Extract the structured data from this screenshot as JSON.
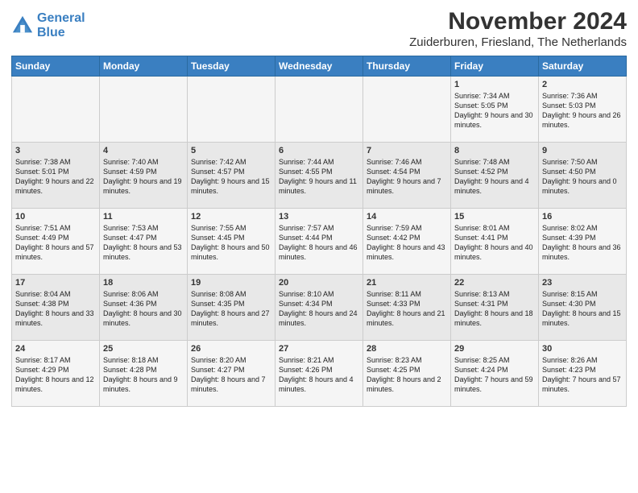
{
  "logo": {
    "line1": "General",
    "line2": "Blue"
  },
  "title": "November 2024",
  "subtitle": "Zuiderburen, Friesland, The Netherlands",
  "days_of_week": [
    "Sunday",
    "Monday",
    "Tuesday",
    "Wednesday",
    "Thursday",
    "Friday",
    "Saturday"
  ],
  "weeks": [
    [
      {
        "day": "",
        "info": ""
      },
      {
        "day": "",
        "info": ""
      },
      {
        "day": "",
        "info": ""
      },
      {
        "day": "",
        "info": ""
      },
      {
        "day": "",
        "info": ""
      },
      {
        "day": "1",
        "info": "Sunrise: 7:34 AM\nSunset: 5:05 PM\nDaylight: 9 hours and 30 minutes."
      },
      {
        "day": "2",
        "info": "Sunrise: 7:36 AM\nSunset: 5:03 PM\nDaylight: 9 hours and 26 minutes."
      }
    ],
    [
      {
        "day": "3",
        "info": "Sunrise: 7:38 AM\nSunset: 5:01 PM\nDaylight: 9 hours and 22 minutes."
      },
      {
        "day": "4",
        "info": "Sunrise: 7:40 AM\nSunset: 4:59 PM\nDaylight: 9 hours and 19 minutes."
      },
      {
        "day": "5",
        "info": "Sunrise: 7:42 AM\nSunset: 4:57 PM\nDaylight: 9 hours and 15 minutes."
      },
      {
        "day": "6",
        "info": "Sunrise: 7:44 AM\nSunset: 4:55 PM\nDaylight: 9 hours and 11 minutes."
      },
      {
        "day": "7",
        "info": "Sunrise: 7:46 AM\nSunset: 4:54 PM\nDaylight: 9 hours and 7 minutes."
      },
      {
        "day": "8",
        "info": "Sunrise: 7:48 AM\nSunset: 4:52 PM\nDaylight: 9 hours and 4 minutes."
      },
      {
        "day": "9",
        "info": "Sunrise: 7:50 AM\nSunset: 4:50 PM\nDaylight: 9 hours and 0 minutes."
      }
    ],
    [
      {
        "day": "10",
        "info": "Sunrise: 7:51 AM\nSunset: 4:49 PM\nDaylight: 8 hours and 57 minutes."
      },
      {
        "day": "11",
        "info": "Sunrise: 7:53 AM\nSunset: 4:47 PM\nDaylight: 8 hours and 53 minutes."
      },
      {
        "day": "12",
        "info": "Sunrise: 7:55 AM\nSunset: 4:45 PM\nDaylight: 8 hours and 50 minutes."
      },
      {
        "day": "13",
        "info": "Sunrise: 7:57 AM\nSunset: 4:44 PM\nDaylight: 8 hours and 46 minutes."
      },
      {
        "day": "14",
        "info": "Sunrise: 7:59 AM\nSunset: 4:42 PM\nDaylight: 8 hours and 43 minutes."
      },
      {
        "day": "15",
        "info": "Sunrise: 8:01 AM\nSunset: 4:41 PM\nDaylight: 8 hours and 40 minutes."
      },
      {
        "day": "16",
        "info": "Sunrise: 8:02 AM\nSunset: 4:39 PM\nDaylight: 8 hours and 36 minutes."
      }
    ],
    [
      {
        "day": "17",
        "info": "Sunrise: 8:04 AM\nSunset: 4:38 PM\nDaylight: 8 hours and 33 minutes."
      },
      {
        "day": "18",
        "info": "Sunrise: 8:06 AM\nSunset: 4:36 PM\nDaylight: 8 hours and 30 minutes."
      },
      {
        "day": "19",
        "info": "Sunrise: 8:08 AM\nSunset: 4:35 PM\nDaylight: 8 hours and 27 minutes."
      },
      {
        "day": "20",
        "info": "Sunrise: 8:10 AM\nSunset: 4:34 PM\nDaylight: 8 hours and 24 minutes."
      },
      {
        "day": "21",
        "info": "Sunrise: 8:11 AM\nSunset: 4:33 PM\nDaylight: 8 hours and 21 minutes."
      },
      {
        "day": "22",
        "info": "Sunrise: 8:13 AM\nSunset: 4:31 PM\nDaylight: 8 hours and 18 minutes."
      },
      {
        "day": "23",
        "info": "Sunrise: 8:15 AM\nSunset: 4:30 PM\nDaylight: 8 hours and 15 minutes."
      }
    ],
    [
      {
        "day": "24",
        "info": "Sunrise: 8:17 AM\nSunset: 4:29 PM\nDaylight: 8 hours and 12 minutes."
      },
      {
        "day": "25",
        "info": "Sunrise: 8:18 AM\nSunset: 4:28 PM\nDaylight: 8 hours and 9 minutes."
      },
      {
        "day": "26",
        "info": "Sunrise: 8:20 AM\nSunset: 4:27 PM\nDaylight: 8 hours and 7 minutes."
      },
      {
        "day": "27",
        "info": "Sunrise: 8:21 AM\nSunset: 4:26 PM\nDaylight: 8 hours and 4 minutes."
      },
      {
        "day": "28",
        "info": "Sunrise: 8:23 AM\nSunset: 4:25 PM\nDaylight: 8 hours and 2 minutes."
      },
      {
        "day": "29",
        "info": "Sunrise: 8:25 AM\nSunset: 4:24 PM\nDaylight: 7 hours and 59 minutes."
      },
      {
        "day": "30",
        "info": "Sunrise: 8:26 AM\nSunset: 4:23 PM\nDaylight: 7 hours and 57 minutes."
      }
    ]
  ]
}
